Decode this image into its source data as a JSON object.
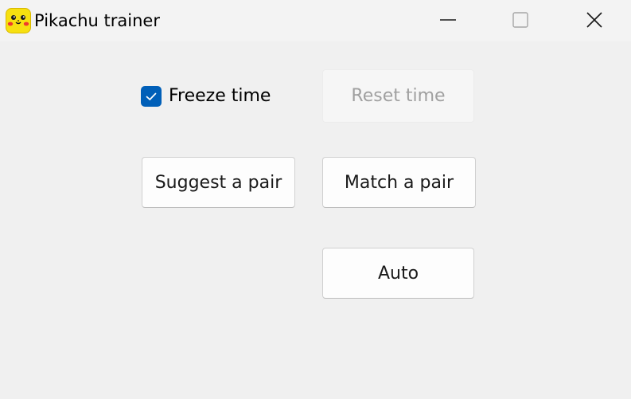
{
  "window": {
    "title": "Pikachu trainer",
    "icon": "pikachu-face-icon",
    "controls": [
      "minimize-icon",
      "maximize-icon",
      "close-icon"
    ]
  },
  "options": {
    "freeze_time": {
      "label": "Freeze time",
      "checked": true
    }
  },
  "buttons": {
    "reset_time": {
      "label": "Reset time",
      "enabled": false
    },
    "suggest_pair": {
      "label": "Suggest a pair",
      "enabled": true
    },
    "match_pair": {
      "label": "Match a pair",
      "enabled": true
    },
    "auto": {
      "label": "Auto",
      "enabled": true
    }
  },
  "colors": {
    "accent": "#005fb8",
    "window_background": "#f0f0f0",
    "icon_yellow": "#f7e010"
  }
}
